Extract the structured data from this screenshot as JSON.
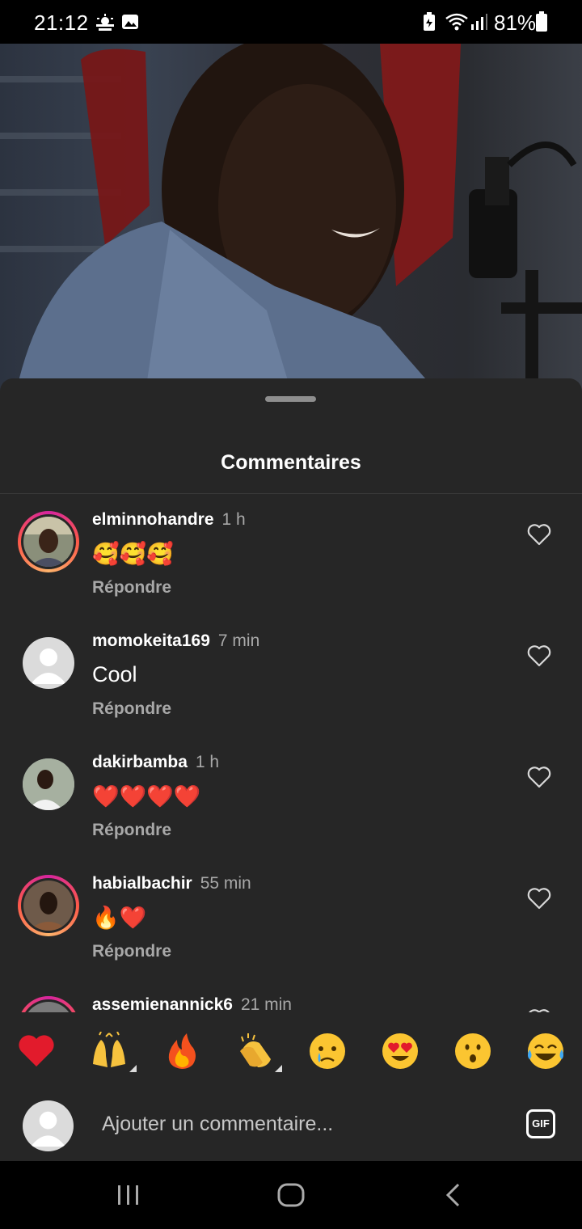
{
  "status_bar": {
    "time": "21:12",
    "battery": "81%"
  },
  "sheet": {
    "title": "Commentaires"
  },
  "comments": [
    {
      "username": "elminnohandre",
      "time": "1 h",
      "text": "🥰🥰🥰",
      "reply": "Répondre",
      "story_ring": true
    },
    {
      "username": "momokeita169",
      "time": "7 min",
      "text": "Cool",
      "reply": "Répondre",
      "story_ring": false
    },
    {
      "username": "dakirbamba",
      "time": "1 h",
      "text": "❤️❤️❤️❤️",
      "reply": "Répondre",
      "story_ring": false
    },
    {
      "username": "habialbachir",
      "time": "55 min",
      "text": "🔥❤️",
      "reply": "Répondre",
      "story_ring": true
    },
    {
      "username": "assemienannick6",
      "time": "21 min",
      "text": "",
      "reply": "",
      "story_ring": true
    }
  ],
  "quick_reactions": [
    "heart",
    "raising-hands",
    "fire",
    "clapping-hands",
    "crying-face",
    "heart-eyes-face",
    "surprised-face",
    "tears-of-joy-face"
  ],
  "composer": {
    "placeholder": "Ajouter un commentaire...",
    "gif_label": "GIF"
  }
}
